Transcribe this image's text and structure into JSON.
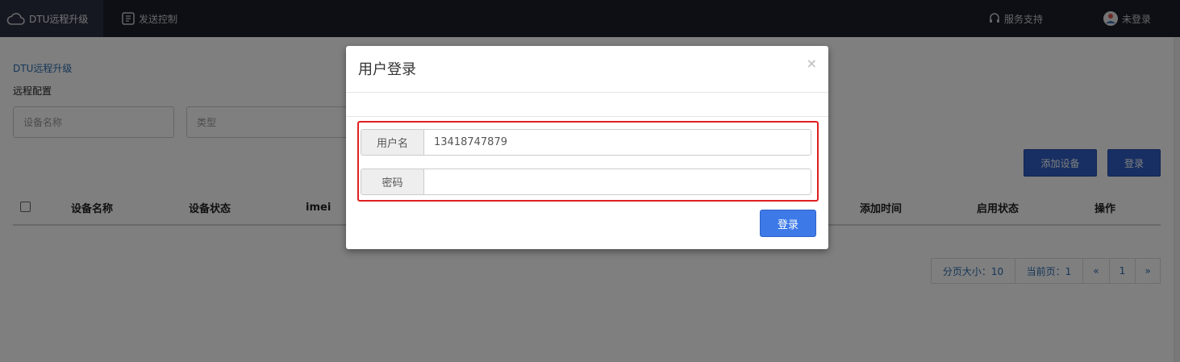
{
  "topnav": {
    "app_item": "DTU远程升级",
    "send_item": "发送控制",
    "support": "服务支持",
    "user": "未登录"
  },
  "page": {
    "breadcrumb": "DTU远程升级",
    "section_title": "远程配置",
    "filters": {
      "device_name_placeholder": "设备名称",
      "type_placeholder": "类型"
    },
    "buttons": {
      "add_device": "添加设备",
      "login": "登录"
    },
    "table": {
      "columns": [
        "设备名称",
        "设备状态",
        "imei",
        "添加时间",
        "启用状态",
        "操作"
      ]
    },
    "pagination": {
      "page_size": "分页大小：10",
      "current_page": "当前页：1",
      "prev": "«",
      "page": "1",
      "next": "»"
    }
  },
  "modal": {
    "title": "用户登录",
    "close": "×",
    "username_label": "用户名",
    "username_value": "13418747879",
    "password_label": "密码",
    "password_value": "",
    "submit": "登录"
  },
  "colors": {
    "topbar": "#1b1f29",
    "primary": "#2f5ec4",
    "modal_button": "#3d7ae8",
    "highlight": "#e02020"
  }
}
